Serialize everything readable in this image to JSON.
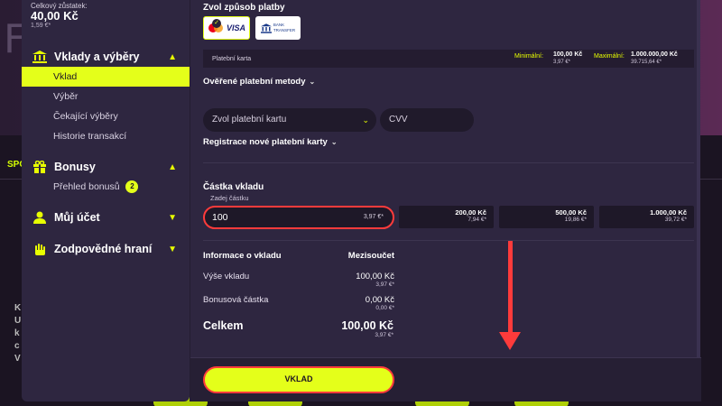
{
  "balance": {
    "label": "Celkový zůstatek:",
    "amount": "40,00 Kč",
    "eur": "1,59 €*"
  },
  "background": {
    "tab": "SPO",
    "letter": "F",
    "side_marks": [
      "K",
      "U",
      "k",
      "c",
      "V"
    ]
  },
  "sidebar": {
    "groups": [
      {
        "label": "Vklady a výběry",
        "icon": "bank-icon",
        "expanded": true,
        "items": [
          "Vklad",
          "Výběr",
          "Čekající výběry",
          "Historie transakcí"
        ]
      },
      {
        "label": "Bonusy",
        "icon": "gift-icon",
        "expanded": true,
        "items": [
          "Přehled bonusů"
        ],
        "badge": "2"
      },
      {
        "label": "Můj účet",
        "icon": "user-icon",
        "expanded": false
      },
      {
        "label": "Zodpovědné hraní",
        "icon": "hand-icon",
        "expanded": false
      }
    ],
    "active_item": "Vklad"
  },
  "payment": {
    "title": "Zvol způsob platby",
    "card_method": "VISA",
    "bank_method_line1": "BANK",
    "bank_method_line2": "TRANSFER",
    "method_name": "Platební karta",
    "min_label": "Minimální:",
    "min_value": "100,00 Kč",
    "min_eur": "3,97 €*",
    "max_label": "Maximální:",
    "max_value": "1.000.000,00 Kč",
    "max_eur": "39.715,64 €*"
  },
  "verified": {
    "label": "Ověřené platební metody"
  },
  "card_select": {
    "placeholder": "Zvol platební kartu",
    "cvv": "CVV"
  },
  "register_card": {
    "label": "Registrace nové platební karty"
  },
  "amount": {
    "title": "Částka vkladu",
    "sublabel": "Zadej částku",
    "value": "100",
    "value_eur": "3,97 €*",
    "quick": [
      {
        "amount": "200,00 Kč",
        "eur": "7,94 €*"
      },
      {
        "amount": "500,00 Kč",
        "eur": "19,86 €*"
      },
      {
        "amount": "1.000,00 Kč",
        "eur": "39,72 €*"
      }
    ]
  },
  "info": {
    "header_left": "Informace o vkladu",
    "header_right": "Mezisoučet",
    "rows": [
      {
        "label": "Výše vkladu",
        "value": "100,00 Kč",
        "eur": "3,97 €*"
      },
      {
        "label": "Bonusová částka",
        "value": "0,00 Kč",
        "eur": "0,00 €*"
      }
    ],
    "total_label": "Celkem",
    "total_value": "100,00 Kč",
    "total_eur": "3,97 €*"
  },
  "submit": {
    "label": "VKLAD"
  },
  "colors": {
    "accent": "#e4ff1a",
    "highlight": "#ff3b3b",
    "panel": "#2e2640"
  }
}
